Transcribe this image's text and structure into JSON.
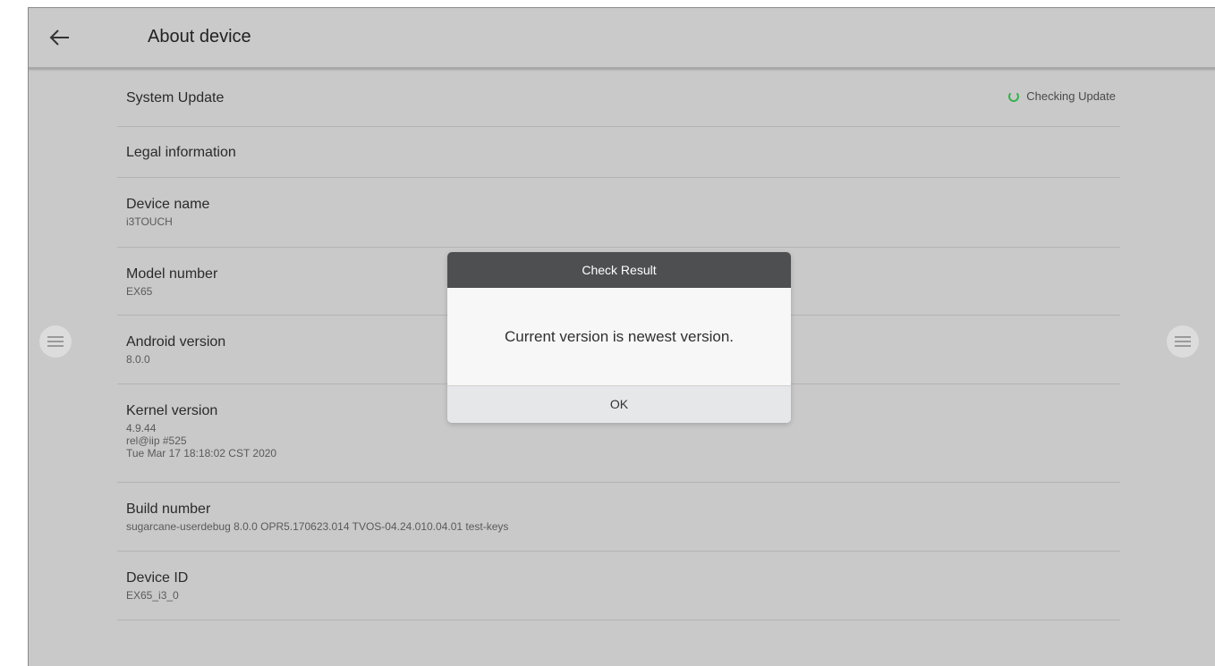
{
  "header": {
    "title": "About device"
  },
  "rows": [
    {
      "title": "System Update",
      "status": "Checking Update"
    },
    {
      "title": "Legal information"
    },
    {
      "title": "Device name",
      "value": "i3TOUCH"
    },
    {
      "title": "Model number",
      "value": "EX65"
    },
    {
      "title": "Android version",
      "value": "8.0.0"
    },
    {
      "title": "Kernel version",
      "lines": [
        "4.9.44",
        "rel@iip #525",
        "Tue Mar 17 18:18:02 CST 2020"
      ]
    },
    {
      "title": "Build number",
      "value": "sugarcane-userdebug 8.0.0 OPR5.170623.014 TVOS-04.24.010.04.01 test-keys"
    },
    {
      "title": "Device ID",
      "value": "EX65_i3_0"
    }
  ],
  "dialog": {
    "title": "Check Result",
    "message": "Current version is newest version.",
    "ok_label": "OK"
  },
  "colors": {
    "status_spinner": "#34b24c",
    "dialog_header": "#4e4f51",
    "background": "#c9c9c9"
  },
  "icons": {
    "back": "arrow-left-icon",
    "side_menu": "menu-lines-icon",
    "status": "spinner-icon"
  }
}
